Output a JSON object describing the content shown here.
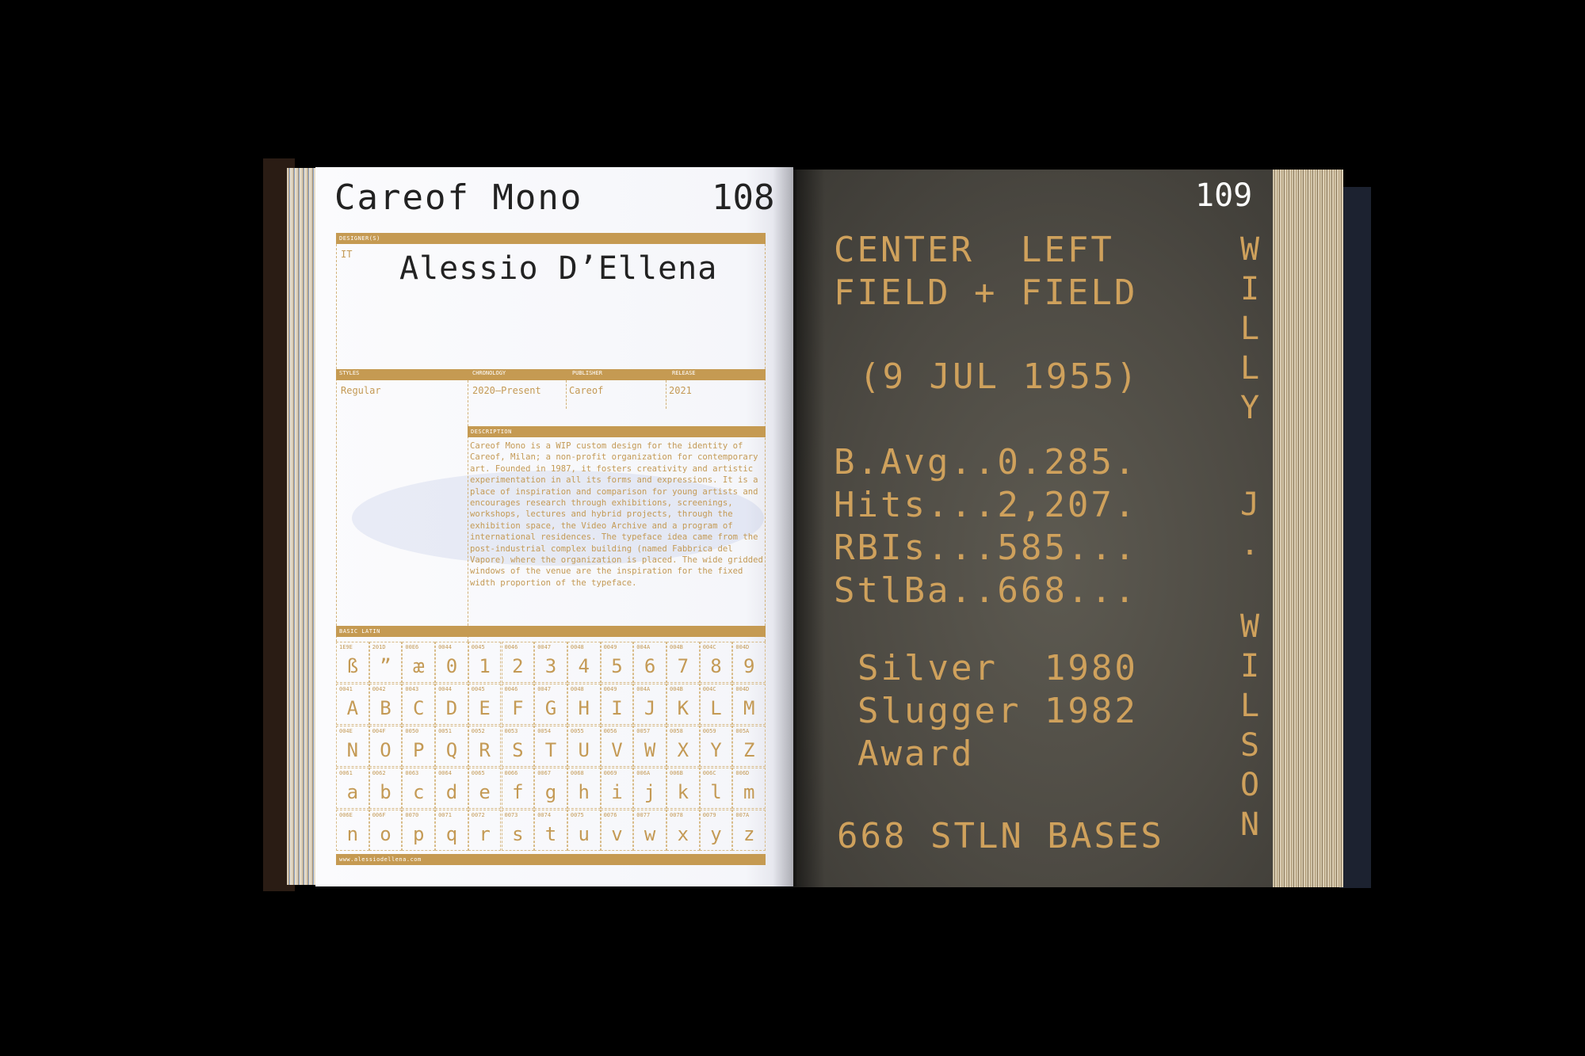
{
  "left_page": {
    "title": "Careof Mono",
    "page_number": "108",
    "designer_label": "DESIGNER(S)",
    "country": "IT",
    "designer": "Alessio D’Ellena",
    "styles_label": "STYLES",
    "styles": "Regular",
    "chronology_label": "CHRONOLOGY",
    "chronology": "2020–Present",
    "publisher_label": "PUBLISHER",
    "publisher": "Careof",
    "release_label": "RELEASE",
    "release": "2021",
    "description_label": "DESCRIPTION",
    "description": "Careof Mono is a WIP custom design for the identity of Careof, Milan; a non-profit organization for contemporary art. Founded in 1987, it fosters creativity and artistic experimentation in all its forms and expressions. It is a place of inspiration and comparison for young artists and encourages research through exhibitions, screenings, workshops, lectures and hybrid projects, through the exhibition space, the Video Archive and a program of international residences. The typeface idea came from the post-industrial complex building (named Fabbrica del Vapore) where the organization is placed. The wide gridded windows of the venue are the inspiration for the fixed width proportion of the typeface.",
    "grid_label": "BASIC LATIN",
    "url": "www.alessiodellena.com",
    "glyph_rows": [
      [
        [
          "1E9E",
          "ß"
        ],
        [
          "201D",
          "”"
        ],
        [
          "00E6",
          "æ"
        ],
        [
          "0044",
          "0"
        ],
        [
          "0045",
          "1"
        ],
        [
          "0046",
          "2"
        ],
        [
          "0047",
          "3"
        ],
        [
          "0048",
          "4"
        ],
        [
          "0049",
          "5"
        ],
        [
          "004A",
          "6"
        ],
        [
          "004B",
          "7"
        ],
        [
          "004C",
          "8"
        ],
        [
          "004D",
          "9"
        ]
      ],
      [
        [
          "0041",
          "A"
        ],
        [
          "0042",
          "B"
        ],
        [
          "0043",
          "C"
        ],
        [
          "0044",
          "D"
        ],
        [
          "0045",
          "E"
        ],
        [
          "0046",
          "F"
        ],
        [
          "0047",
          "G"
        ],
        [
          "0048",
          "H"
        ],
        [
          "0049",
          "I"
        ],
        [
          "004A",
          "J"
        ],
        [
          "004B",
          "K"
        ],
        [
          "004C",
          "L"
        ],
        [
          "004D",
          "M"
        ]
      ],
      [
        [
          "004E",
          "N"
        ],
        [
          "004F",
          "O"
        ],
        [
          "0050",
          "P"
        ],
        [
          "0051",
          "Q"
        ],
        [
          "0052",
          "R"
        ],
        [
          "0053",
          "S"
        ],
        [
          "0054",
          "T"
        ],
        [
          "0055",
          "U"
        ],
        [
          "0056",
          "V"
        ],
        [
          "0057",
          "W"
        ],
        [
          "0058",
          "X"
        ],
        [
          "0059",
          "Y"
        ],
        [
          "005A",
          "Z"
        ]
      ],
      [
        [
          "0061",
          "a"
        ],
        [
          "0062",
          "b"
        ],
        [
          "0063",
          "c"
        ],
        [
          "0064",
          "d"
        ],
        [
          "0065",
          "e"
        ],
        [
          "0066",
          "f"
        ],
        [
          "0067",
          "g"
        ],
        [
          "0068",
          "h"
        ],
        [
          "0069",
          "i"
        ],
        [
          "006A",
          "j"
        ],
        [
          "006B",
          "k"
        ],
        [
          "006C",
          "l"
        ],
        [
          "006D",
          "m"
        ]
      ],
      [
        [
          "006E",
          "n"
        ],
        [
          "006F",
          "o"
        ],
        [
          "0070",
          "p"
        ],
        [
          "0071",
          "q"
        ],
        [
          "0072",
          "r"
        ],
        [
          "0073",
          "s"
        ],
        [
          "0074",
          "t"
        ],
        [
          "0075",
          "u"
        ],
        [
          "0076",
          "v"
        ],
        [
          "0077",
          "w"
        ],
        [
          "0078",
          "x"
        ],
        [
          "0079",
          "y"
        ],
        [
          "007A",
          "z"
        ]
      ]
    ]
  },
  "right_page": {
    "page_number": "109",
    "line1": "CENTER  LEFT",
    "line2": "FIELD + FIELD",
    "line3": "(9 JUL 1955)",
    "stat1": "B.Avg..0.285.",
    "stat2": "Hits...2,207.",
    "stat3": "RBIs...585...",
    "stat4": "StlBa..668...",
    "award1": "Silver  1980",
    "award2": "Slugger 1982",
    "award3": "Award",
    "bottom": "668 STLN BASES",
    "vertical_top": [
      "W",
      "I",
      "L",
      "L",
      "Y"
    ],
    "vertical_mid": [
      "J",
      "."
    ],
    "vertical_bottom": [
      "W",
      "I",
      "L",
      "S",
      "O",
      "N"
    ]
  },
  "colors": {
    "gold": "#c59a52",
    "dark_page": "#4d4a43",
    "background": "#000000"
  }
}
